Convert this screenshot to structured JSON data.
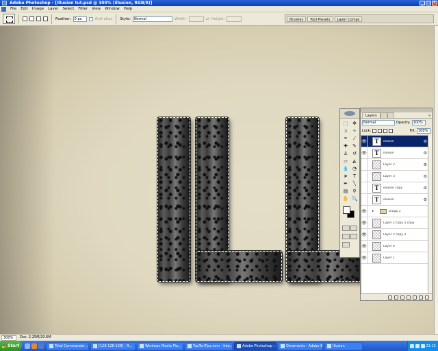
{
  "window": {
    "title": "Adobe Photoshop - [illusion tut.psd @ 300% (illusion, RGB/8)]",
    "minimize": "_",
    "maximize": "□",
    "close": "×"
  },
  "menu": [
    "File",
    "Edit",
    "Image",
    "Layer",
    "Select",
    "Filter",
    "View",
    "Window",
    "Help"
  ],
  "options": {
    "feather_label": "Feather:",
    "feather_value": "0 px",
    "antialias_label": "Anti-alias",
    "style_label": "Style:",
    "style_value": "Normal",
    "width_label": "Width:",
    "height_label": "Height:",
    "palette_tabs": [
      "Brushes",
      "Tool Presets",
      "Layer Comps"
    ]
  },
  "layers_panel": {
    "tabs": [
      "Layers",
      "Channels",
      "Paths"
    ],
    "menu_icon": "»",
    "blend_mode": "Normal",
    "opacity_label": "Opacity:",
    "opacity_value": "100%",
    "lock_label": "Lock:",
    "fill_label": "Fill:",
    "fill_value": "100%",
    "layers": [
      {
        "name": "illusion",
        "kind": "type",
        "visible": true,
        "selected": true,
        "fx": true
      },
      {
        "name": "illusion",
        "kind": "type",
        "visible": true,
        "selected": false,
        "fx": true
      },
      {
        "name": "Layer 2",
        "kind": "raster",
        "visible": false,
        "selected": false,
        "fx": true
      },
      {
        "name": "Layer 3",
        "kind": "raster",
        "visible": false,
        "selected": false,
        "fx": true
      },
      {
        "name": "illusion copy",
        "kind": "type",
        "visible": false,
        "selected": false,
        "fx": true
      },
      {
        "name": "illusion",
        "kind": "type",
        "visible": false,
        "selected": false,
        "fx": true
      },
      {
        "name": "Group 1",
        "kind": "group",
        "visible": true,
        "selected": false,
        "fx": false
      },
      {
        "name": "Layer 2 copy 2 copy",
        "kind": "raster",
        "visible": true,
        "selected": false,
        "fx": false
      },
      {
        "name": "Layer 2 copy 2",
        "kind": "raster",
        "visible": true,
        "selected": false,
        "fx": false
      },
      {
        "name": "Layer 4",
        "kind": "raster",
        "visible": true,
        "selected": false,
        "fx": false
      },
      {
        "name": "Layer 1",
        "kind": "raster",
        "visible": true,
        "selected": false,
        "fx": false
      }
    ]
  },
  "status": {
    "zoom": "300%",
    "doc": "Doc: 2.25M/20.6M"
  },
  "taskbar": {
    "start": "Start",
    "tasks": [
      "Total Commander ...",
      "[128-128-128] - R...",
      "Windows Media Pla...",
      "TopTenTips.com - Inte...",
      "Adobe Photoshop -...",
      "Ornaments - Adobe Br...",
      "Illusion"
    ],
    "active_task": 4,
    "clock": "21:15"
  }
}
